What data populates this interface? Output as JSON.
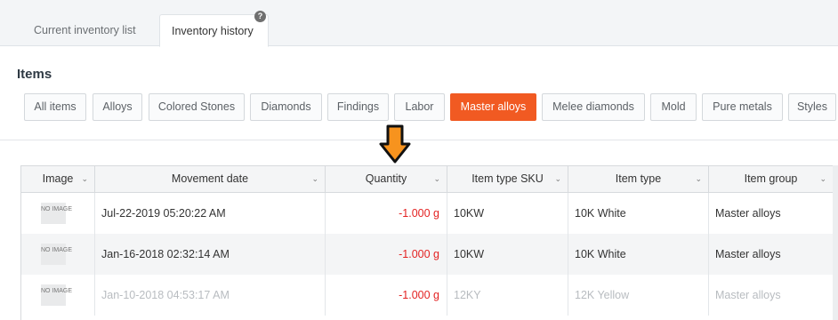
{
  "tabs": [
    {
      "label": "Current inventory list",
      "active": false
    },
    {
      "label": "Inventory history",
      "active": true
    }
  ],
  "help_icon": "?",
  "section_title": "Items",
  "filters": [
    {
      "label": "All items"
    },
    {
      "label": "Alloys"
    },
    {
      "label": "Colored Stones"
    },
    {
      "label": "Diamonds"
    },
    {
      "label": "Findings"
    },
    {
      "label": "Labor"
    },
    {
      "label": "Master alloys",
      "active": true
    },
    {
      "label": "Melee diamonds"
    },
    {
      "label": "Mold"
    },
    {
      "label": "Pure metals"
    },
    {
      "label": "Styles"
    }
  ],
  "accent_color": "#f15a22",
  "annotation_arrow": "arrow-down-icon",
  "columns": [
    "Image",
    "Movement date",
    "Quantity",
    "Item type SKU",
    "Item type",
    "Item group"
  ],
  "rows": [
    {
      "image": "NO IMAGE",
      "date": "Jul-22-2019 05:20:22 AM",
      "quantity": "-1.000 g",
      "sku": "10KW",
      "item_type": "10K White",
      "item_group": "Master alloys"
    },
    {
      "image": "NO IMAGE",
      "date": "Jan-16-2018 02:32:14 AM",
      "quantity": "-1.000 g",
      "sku": "10KW",
      "item_type": "10K White",
      "item_group": "Master alloys"
    },
    {
      "image": "NO IMAGE",
      "date": "Jan-10-2018 04:53:17 AM",
      "quantity": "-1.000 g",
      "sku": "12KY",
      "item_type": "12K Yellow",
      "item_group": "Master alloys"
    }
  ]
}
